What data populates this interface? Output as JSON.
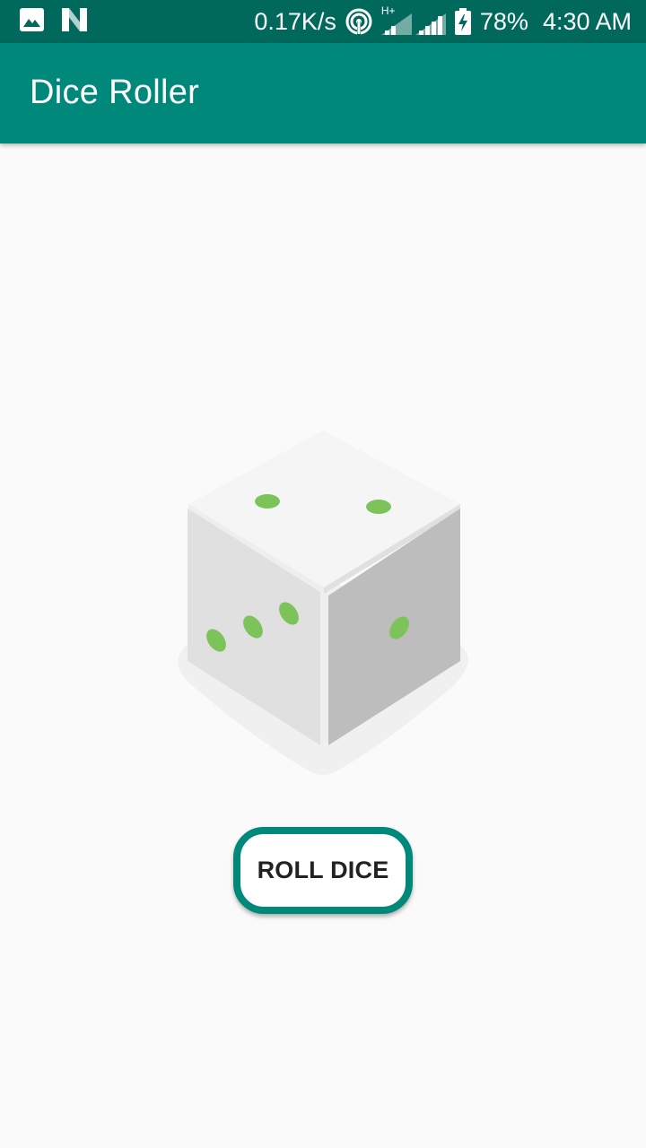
{
  "status_bar": {
    "network_speed": "0.17K/s",
    "network_type": "H+",
    "battery": "78%",
    "time": "4:30 AM",
    "icons": [
      "image-icon",
      "n-logo-icon",
      "hotspot-icon",
      "signal-icon",
      "battery-charging-icon"
    ]
  },
  "app_bar": {
    "title": "Dice Roller",
    "color": "#00897b"
  },
  "dice": {
    "icon": "dice-icon",
    "pip_color": "#7cc35a",
    "top_face_pips": 2,
    "left_face_pips": 3,
    "right_face_pips": 1
  },
  "roll_button": {
    "label": "ROLL DICE"
  },
  "colors": {
    "status_bar": "#00695c",
    "accent": "#00897b",
    "background": "#fafafa"
  }
}
